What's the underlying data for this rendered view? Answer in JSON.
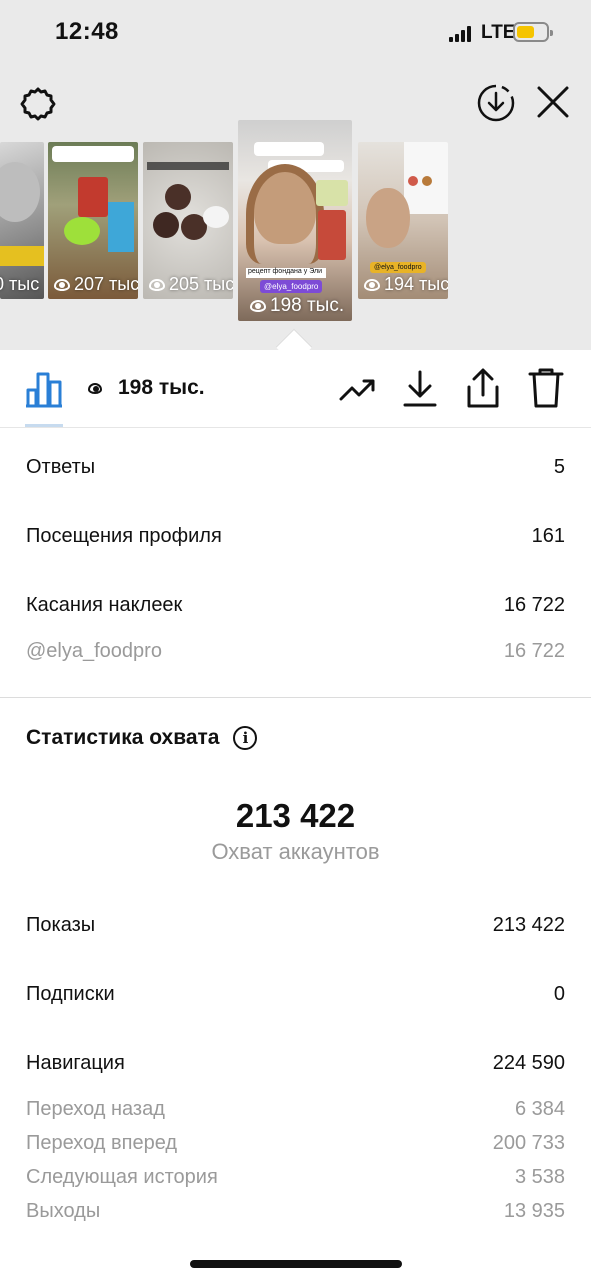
{
  "status_bar": {
    "time": "12:48",
    "network": "LTE",
    "battery_color": "#f5c400"
  },
  "header": {
    "settings_icon": "gear-icon",
    "download_icon": "download-circle-icon",
    "close_icon": "close-icon"
  },
  "stories": [
    {
      "views": "0 тыс",
      "theme": "gray-portrait"
    },
    {
      "views": "207 тыс",
      "theme": "snacks"
    },
    {
      "views": "205 тыс",
      "theme": "donuts"
    },
    {
      "views": "198 тыс.",
      "theme": "selected-portrait",
      "tag": "@elya_foodpro",
      "caption": "рецепт фондана у Эли"
    },
    {
      "views": "194 тыс.",
      "theme": "portrait-screens",
      "tag": "@elya_foodpro"
    }
  ],
  "toolbar": {
    "views": "198 тыс.",
    "icons": [
      "bar-chart-icon",
      "eye-icon",
      "trending-icon",
      "download-icon",
      "share-icon",
      "trash-icon"
    ]
  },
  "interactions": [
    {
      "label": "Ответы",
      "value": "5"
    },
    {
      "label": "Посещения профиля",
      "value": "161"
    },
    {
      "label": "Касания наклеек",
      "value": "16 722"
    }
  ],
  "sticker_detail": {
    "label": "@elya_foodpro",
    "value": "16 722"
  },
  "reach": {
    "title": "Статистика охвата",
    "total": "213 422",
    "total_label": "Охват аккаунтов",
    "rows": [
      {
        "label": "Показы",
        "value": "213 422"
      },
      {
        "label": "Подписки",
        "value": "0"
      },
      {
        "label": "Навигация",
        "value": "224 590"
      }
    ],
    "navigation_details": [
      {
        "label": "Переход назад",
        "value": "6 384"
      },
      {
        "label": "Переход вперед",
        "value": "200 733"
      },
      {
        "label": "Следующая история",
        "value": "3 538"
      },
      {
        "label": "Выходы",
        "value": "13 935"
      }
    ]
  }
}
